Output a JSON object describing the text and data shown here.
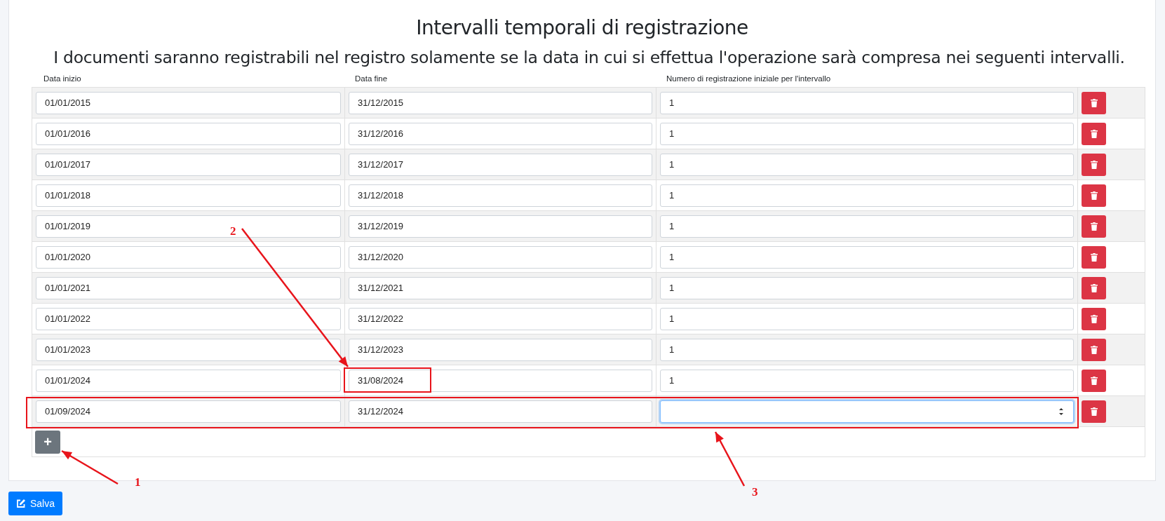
{
  "title": "Intervalli temporali di registrazione",
  "subtitle": "I documenti saranno registrabili nel registro solamente se la data in cui si effettua l'operazione sarà compresa nei seguenti intervalli.",
  "columns": [
    "Data inizio",
    "Data fine",
    "Numero di registrazione iniziale per l'intervallo"
  ],
  "rows": [
    {
      "inizio": "01/01/2015",
      "fine": "31/12/2015",
      "numero": "1",
      "focused": false
    },
    {
      "inizio": "01/01/2016",
      "fine": "31/12/2016",
      "numero": "1",
      "focused": false
    },
    {
      "inizio": "01/01/2017",
      "fine": "31/12/2017",
      "numero": "1",
      "focused": false
    },
    {
      "inizio": "01/01/2018",
      "fine": "31/12/2018",
      "numero": "1",
      "focused": false
    },
    {
      "inizio": "01/01/2019",
      "fine": "31/12/2019",
      "numero": "1",
      "focused": false
    },
    {
      "inizio": "01/01/2020",
      "fine": "31/12/2020",
      "numero": "1",
      "focused": false
    },
    {
      "inizio": "01/01/2021",
      "fine": "31/12/2021",
      "numero": "1",
      "focused": false
    },
    {
      "inizio": "01/01/2022",
      "fine": "31/12/2022",
      "numero": "1",
      "focused": false
    },
    {
      "inizio": "01/01/2023",
      "fine": "31/12/2023",
      "numero": "1",
      "focused": false
    },
    {
      "inizio": "01/01/2024",
      "fine": "31/08/2024",
      "numero": "1",
      "focused": false
    },
    {
      "inizio": "01/09/2024",
      "fine": "31/12/2024",
      "focused": true
    }
  ],
  "add_button": "+",
  "save_button": "Salva",
  "annotations": [
    {
      "kind": "arrow",
      "label": "1"
    },
    {
      "kind": "arrow",
      "label": "2"
    },
    {
      "kind": "arrow",
      "label": "3"
    },
    {
      "kind": "box"
    },
    {
      "kind": "box"
    }
  ]
}
